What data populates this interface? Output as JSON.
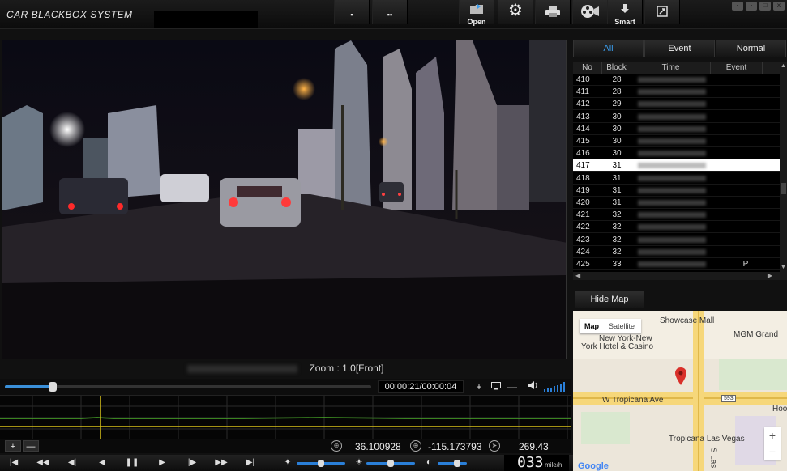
{
  "app": {
    "title": "CAR BLACKBOX SYSTEM"
  },
  "toolbar": {
    "btn1": "▪",
    "btn2": "▪▪",
    "open_label": "Open",
    "smart_label": "Smart"
  },
  "window_buttons": [
    "-",
    "-",
    "□",
    "x"
  ],
  "video": {
    "zoom_text": "Zoom : 1.0[Front]"
  },
  "progress": {
    "fraction": 0.13,
    "time_text": "00:00:21/00:00:04"
  },
  "controls": {
    "plus": "+",
    "minus": "—"
  },
  "graph_controls": {
    "plus": "+",
    "minus": "—"
  },
  "gps": {
    "latitude": "36.100928",
    "longitude": "-115.173793",
    "heading": "269.43"
  },
  "speed": {
    "value": "033",
    "unit": "mile/h"
  },
  "tabs": [
    "All",
    "Event",
    "Normal"
  ],
  "table": {
    "headers": [
      "No",
      "Block",
      "Time",
      "Event"
    ],
    "rows": [
      {
        "no": "410",
        "block": "28",
        "event": ""
      },
      {
        "no": "411",
        "block": "28",
        "event": ""
      },
      {
        "no": "412",
        "block": "29",
        "event": ""
      },
      {
        "no": "413",
        "block": "30",
        "event": ""
      },
      {
        "no": "414",
        "block": "30",
        "event": ""
      },
      {
        "no": "415",
        "block": "30",
        "event": ""
      },
      {
        "no": "416",
        "block": "30",
        "event": ""
      },
      {
        "no": "417",
        "block": "31",
        "event": ""
      },
      {
        "no": "418",
        "block": "31",
        "event": ""
      },
      {
        "no": "419",
        "block": "31",
        "event": ""
      },
      {
        "no": "420",
        "block": "31",
        "event": ""
      },
      {
        "no": "421",
        "block": "32",
        "event": ""
      },
      {
        "no": "422",
        "block": "32",
        "event": ""
      },
      {
        "no": "423",
        "block": "32",
        "event": ""
      },
      {
        "no": "424",
        "block": "32",
        "event": ""
      },
      {
        "no": "425",
        "block": "33",
        "event": "P"
      }
    ],
    "selected_index": 7
  },
  "map_panel": {
    "hide_map_label": "Hide Map",
    "type_map": "Map",
    "type_satellite": "Satellite",
    "labels": {
      "showcase": "Showcase Mall",
      "mgm": "MGM Grand",
      "nyny_1": "New York-New",
      "nyny_2": "York Hotel & Casino",
      "tropicana_ave": "W Tropicana Ave",
      "route": "593",
      "hoo": "Hoo",
      "tropicana_lv": "Tropicana Las Vegas",
      "las": "S Las",
      "google": "Google"
    },
    "zoom_in": "+",
    "zoom_out": "−"
  },
  "colors": {
    "accent": "#3a9bea",
    "graph_green": "#4caf2a",
    "graph_yellow": "#d8c21a",
    "pin": "#d9302a"
  }
}
